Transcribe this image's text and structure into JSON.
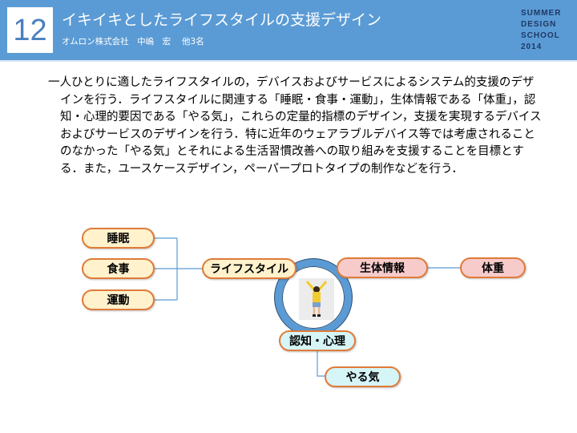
{
  "header": {
    "number": "12",
    "title": "イキイキとしたライフスタイルの支援デザイン",
    "subtitle": "オムロン株式会社　中嶋　宏　 他3名",
    "school_lines": [
      "SUMMER",
      "DESIGN",
      "SCHOOL",
      "2014"
    ],
    "bg_color": "#5b9bd5"
  },
  "body": {
    "text": "一人ひとりに適したライフスタイルの，デバイスおよびサービスによるシステム的支援のデザインを行う．ライフスタイルに関連する「睡眠・食事・運動」，生体情報である「体重」，認知・心理的要因である「やる気」，これらの定量的指標のデザイン，支援を実現するデバイスおよびサービスのデザインを行う．特に近年のウェアラブルデバイス等では考慮されることのなかった「やる気」とそれによる生活習慣改善への取り組みを支援することを目標とする．また，ユースケースデザイン，ペーパープロトタイプの制作などを行う．"
  },
  "diagram": {
    "lifestyle_children": [
      "睡眠",
      "食事",
      "運動"
    ],
    "lifestyle": "ライフスタイル",
    "biometric": "生体情報",
    "weight": "体重",
    "cognition": "認知・心理",
    "motivation": "やる気",
    "colors": {
      "border": "#e07b39",
      "yellow": "#fff2cc",
      "pink": "#f8cbcb",
      "cyan": "#d6f5f7",
      "connector": "#5b9bd5"
    }
  }
}
